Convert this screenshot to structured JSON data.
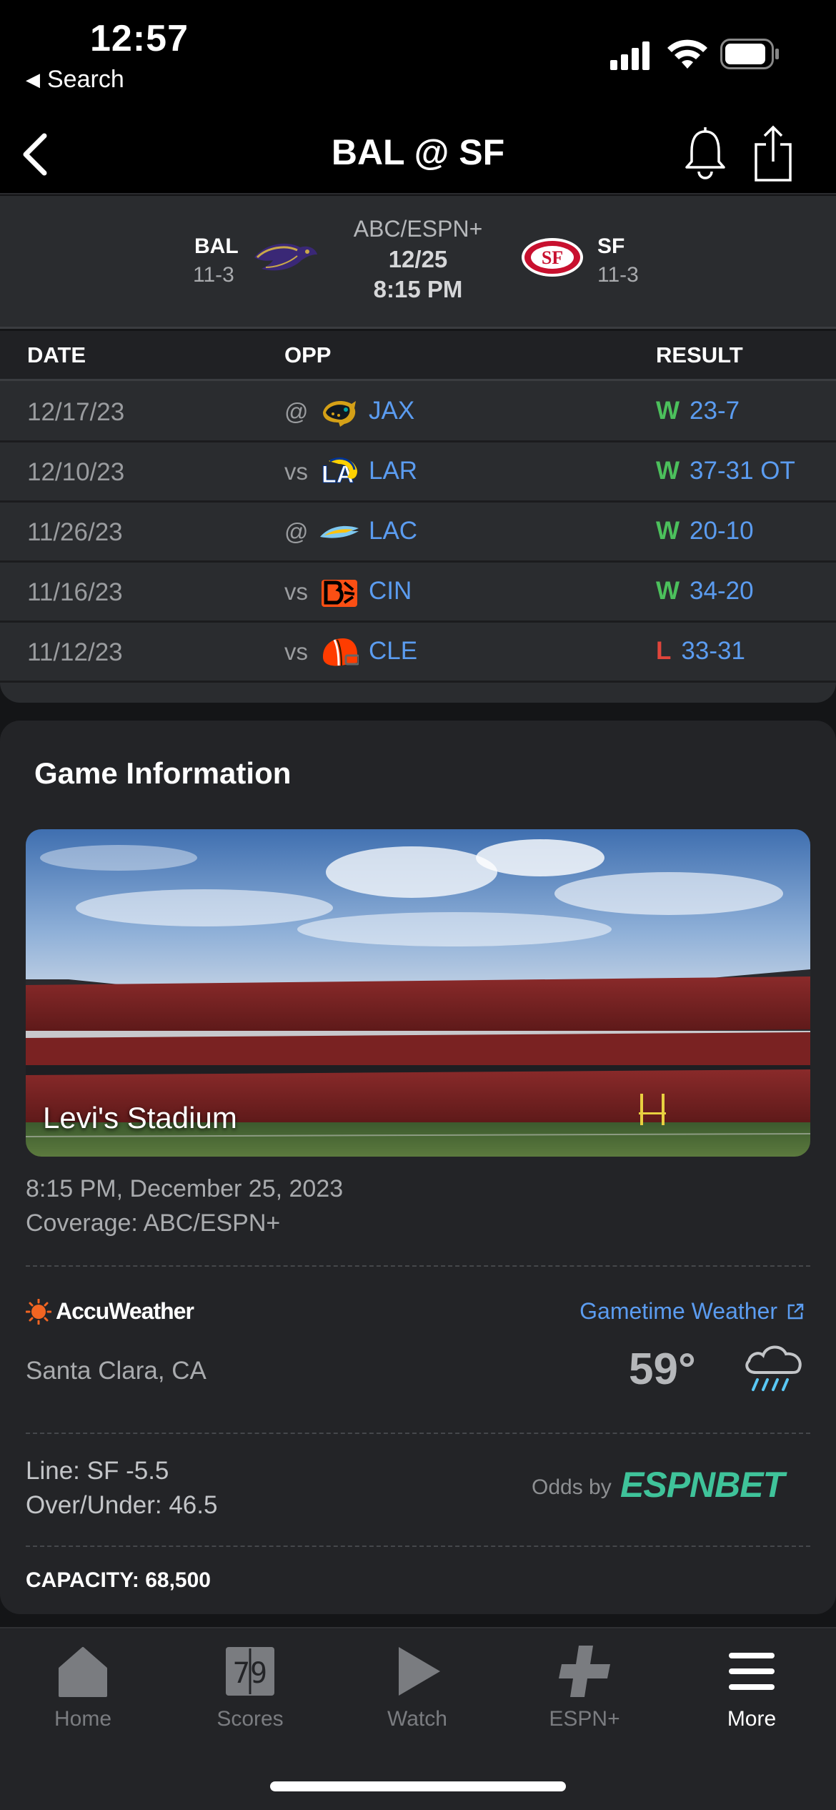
{
  "status_bar": {
    "time": "12:57",
    "back_app": "Search"
  },
  "header": {
    "title": "BAL @ SF"
  },
  "matchup": {
    "away": {
      "abbr": "BAL",
      "record": "11-3"
    },
    "home": {
      "abbr": "SF",
      "record": "11-3"
    },
    "network": "ABC/ESPN+",
    "date": "12/25",
    "time": "8:15 PM"
  },
  "schedule": {
    "headers": {
      "date": "DATE",
      "opp": "OPP",
      "result": "RESULT"
    },
    "rows": [
      {
        "date": "12/17/23",
        "prefix": "@",
        "team": "JAX",
        "outcome": "W",
        "score": "23-7",
        "logo": "jaguars-logo"
      },
      {
        "date": "12/10/23",
        "prefix": "vs",
        "team": "LAR",
        "outcome": "W",
        "score": "37-31 OT",
        "logo": "rams-logo"
      },
      {
        "date": "11/26/23",
        "prefix": "@",
        "team": "LAC",
        "outcome": "W",
        "score": "20-10",
        "logo": "chargers-logo"
      },
      {
        "date": "11/16/23",
        "prefix": "vs",
        "team": "CIN",
        "outcome": "W",
        "score": "34-20",
        "logo": "bengals-logo"
      },
      {
        "date": "11/12/23",
        "prefix": "vs",
        "team": "CLE",
        "outcome": "L",
        "score": "33-31",
        "logo": "browns-logo"
      }
    ]
  },
  "game_info": {
    "title": "Game Information",
    "stadium": "Levi's Stadium",
    "datetime": "8:15 PM, December 25, 2023",
    "coverage": "Coverage: ABC/ESPN+",
    "weather_brand": "AccuWeather",
    "weather_link": "Gametime Weather",
    "location": "Santa Clara, CA",
    "temperature": "59°",
    "weather_icon": "rain-cloud-icon",
    "line": "Line: SF -5.5",
    "over_under": "Over/Under: 46.5",
    "odds_by": "Odds by",
    "odds_brand": "ESPNBET",
    "capacity": "CAPACITY: 68,500"
  },
  "tabbar": {
    "items": [
      {
        "label": "Home",
        "icon": "home-icon"
      },
      {
        "label": "Scores",
        "icon": "scores-icon"
      },
      {
        "label": "Watch",
        "icon": "play-icon"
      },
      {
        "label": "ESPN+",
        "icon": "plus-icon"
      },
      {
        "label": "More",
        "icon": "menu-icon",
        "active": true
      }
    ]
  },
  "colors": {
    "link": "#5b9cf0",
    "win": "#4cc05c",
    "loss": "#e0453b",
    "espnbet": "#3fc39a",
    "accuweather": "#f26522"
  }
}
